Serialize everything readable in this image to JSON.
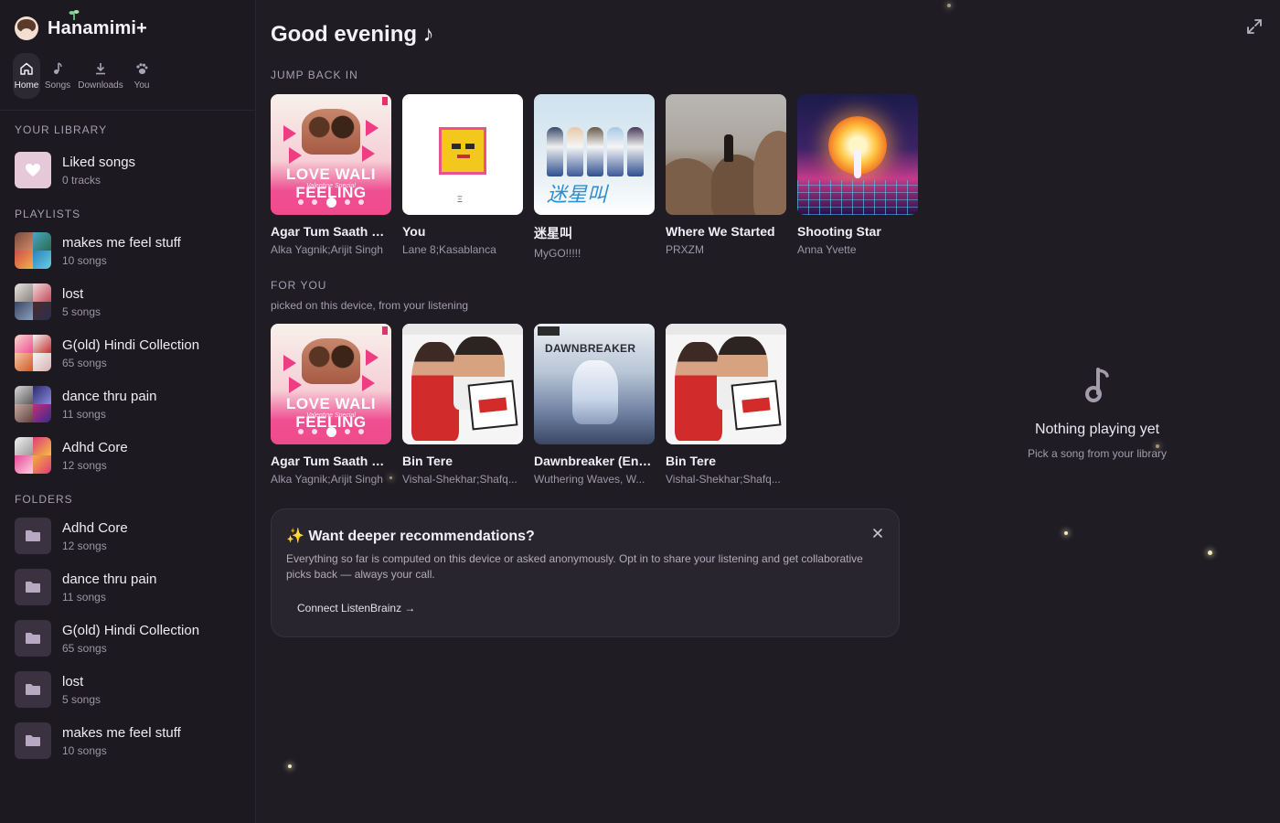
{
  "app": {
    "name": "Hanamimi+"
  },
  "nav": [
    {
      "label": "Home",
      "icon": "home-icon",
      "active": true
    },
    {
      "label": "Songs",
      "icon": "music-note-icon",
      "active": false
    },
    {
      "label": "Downloads",
      "icon": "download-icon",
      "active": false
    },
    {
      "label": "You",
      "icon": "paw-icon",
      "active": false
    }
  ],
  "library": {
    "heading": "YOUR LIBRARY",
    "liked": {
      "title": "Liked songs",
      "count": "0 tracks"
    }
  },
  "playlists": {
    "heading": "PLAYLISTS",
    "items": [
      {
        "title": "makes me feel stuff",
        "count": "10 songs"
      },
      {
        "title": "lost",
        "count": "5 songs"
      },
      {
        "title": "G(old) Hindi Collection",
        "count": "65 songs"
      },
      {
        "title": "dance thru pain",
        "count": "11 songs"
      },
      {
        "title": "Adhd Core",
        "count": "12 songs"
      }
    ]
  },
  "folders": {
    "heading": "FOLDERS",
    "items": [
      {
        "title": "Adhd Core",
        "count": "12 songs"
      },
      {
        "title": "dance thru pain",
        "count": "11 songs"
      },
      {
        "title": "G(old) Hindi Collection",
        "count": "65 songs"
      },
      {
        "title": "lost",
        "count": "5 songs"
      },
      {
        "title": "makes me feel stuff",
        "count": "10 songs"
      }
    ]
  },
  "main": {
    "greeting": "Good evening ♪",
    "jump_back": {
      "heading": "JUMP BACK IN",
      "cards": [
        {
          "title": "Agar Tum Saath Ho...",
          "artist": "Alka Yagnik;Arijit Singh"
        },
        {
          "title": "You",
          "artist": "Lane 8;Kasablanca"
        },
        {
          "title": "迷星叫",
          "artist": "MyGO!!!!!"
        },
        {
          "title": "Where We Started",
          "artist": "PRXZM"
        },
        {
          "title": "Shooting Star",
          "artist": "Anna Yvette"
        }
      ]
    },
    "for_you": {
      "heading": "FOR YOU",
      "subtitle": "picked on this device, from your listening",
      "cards": [
        {
          "title": "Agar Tum Saath Ho...",
          "artist": "Alka Yagnik;Arijit Singh"
        },
        {
          "title": "Bin Tere",
          "artist": "Vishal-Shekhar;Shafq..."
        },
        {
          "title": "Dawnbreaker (Engli...",
          "artist": "Wuthering Waves, W..."
        },
        {
          "title": "Bin Tere",
          "artist": "Vishal-Shekhar;Shafq..."
        }
      ]
    }
  },
  "covers": {
    "feeling": {
      "title": "LOVE WALI FEELING",
      "subtitle": "Valentine Special"
    },
    "mygo": {
      "kanji": "迷星叫"
    },
    "dawnbreaker": {
      "title": "DAWNBREAKER"
    }
  },
  "recommend": {
    "title": "✨ Want deeper recommendations?",
    "body": "Everything so far is computed on this device or asked anonymously. Opt in to share your listening and get collaborative picks back — always your call.",
    "link": "Connect ListenBrainz →"
  },
  "now_playing": {
    "title": "Nothing playing yet",
    "subtitle": "Pick a song from your library"
  },
  "colors": {
    "background": "#1f1c24",
    "sidebar": "#1c1920",
    "panel": "#29252e",
    "liked_tile": "#e6c9d8",
    "folder_tile": "#3a3240"
  }
}
